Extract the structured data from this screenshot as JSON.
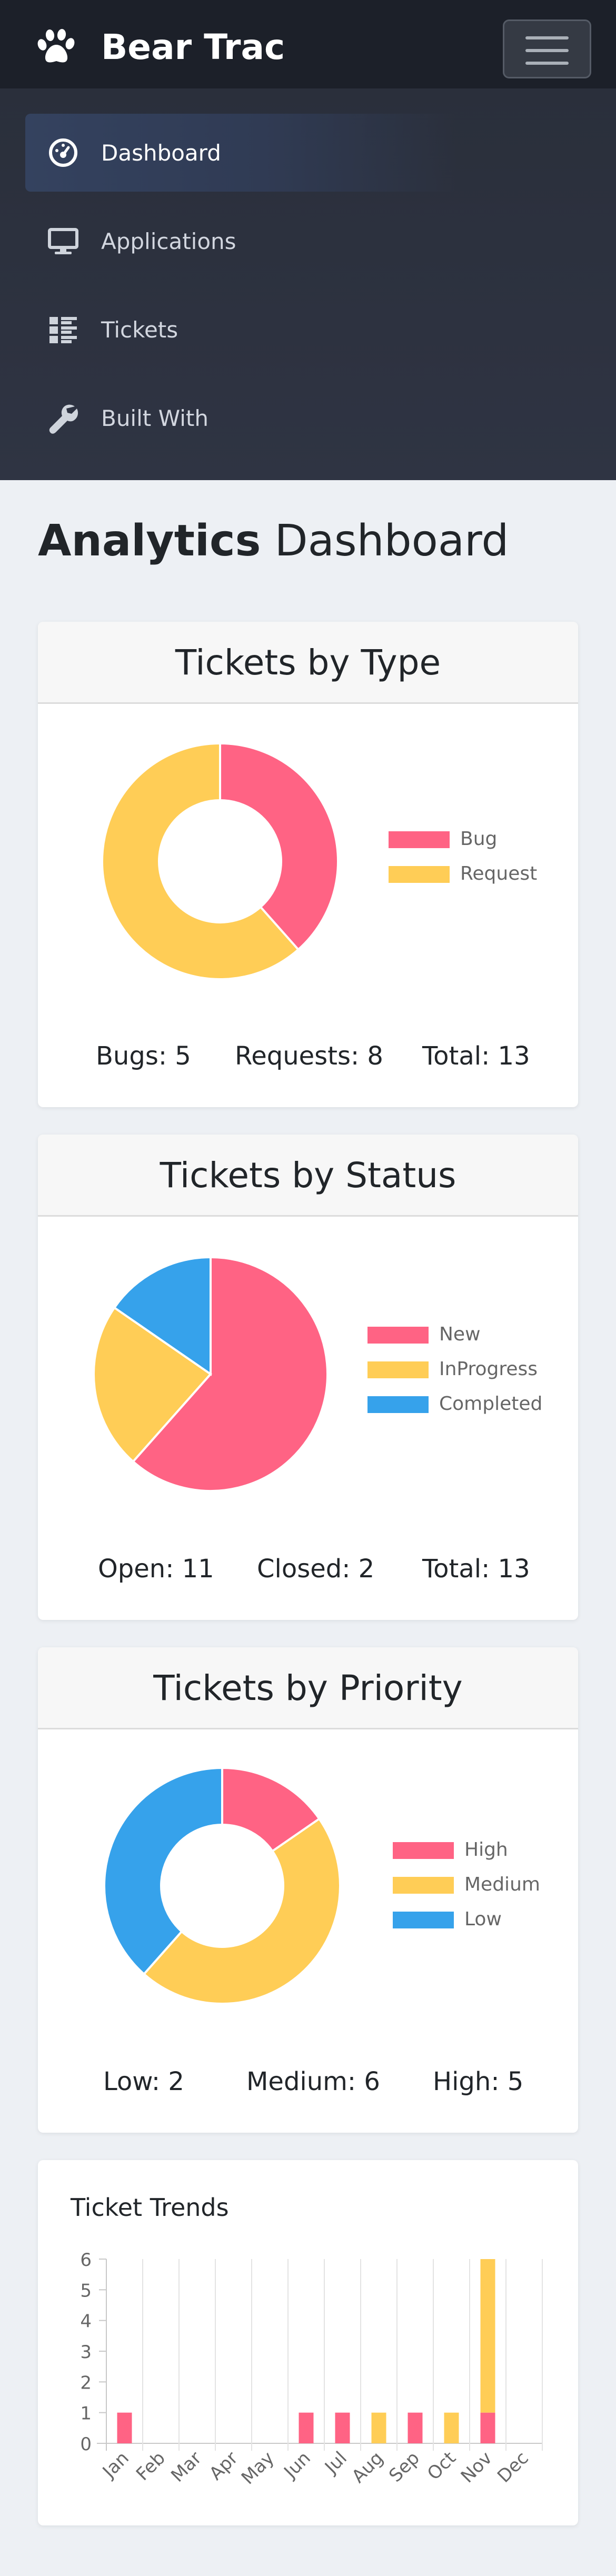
{
  "header": {
    "brand": "Bear Trac",
    "brand_icon": "paw-icon",
    "menu_icon": "hamburger-icon"
  },
  "nav": {
    "items": [
      {
        "label": "Dashboard",
        "icon": "gauge-icon",
        "active": true
      },
      {
        "label": "Applications",
        "icon": "desktop-icon",
        "active": false
      },
      {
        "label": "Tickets",
        "icon": "list-icon",
        "active": false
      },
      {
        "label": "Built With",
        "icon": "wrench-icon",
        "active": false
      }
    ]
  },
  "page": {
    "title_bold": "Analytics",
    "title_rest": " Dashboard"
  },
  "colors": {
    "pink": "#ff6384",
    "yellow": "#ffcd56",
    "blue": "#36a2eb"
  },
  "cards": {
    "by_type": {
      "title": "Tickets by Type",
      "stats": [
        "Bugs: 5",
        "Requests: 8",
        "Total: 13"
      ]
    },
    "by_status": {
      "title": "Tickets by Status",
      "stats": [
        "Open: 11",
        "Closed: 2",
        "Total: 13"
      ]
    },
    "by_priority": {
      "title": "Tickets by Priority",
      "stats": [
        "Low: 2",
        "Medium: 6",
        "High: 5"
      ]
    },
    "trends": {
      "title": "Ticket Trends"
    }
  },
  "chart_data": [
    {
      "type": "pie",
      "variant": "doughnut",
      "categories": [
        "Bug",
        "Request"
      ],
      "values": [
        5,
        8
      ],
      "colors": [
        "#ff6384",
        "#ffcd56"
      ],
      "legend": "right"
    },
    {
      "type": "pie",
      "categories": [
        "New",
        "InProgress",
        "Completed"
      ],
      "values": [
        8,
        3,
        2
      ],
      "colors": [
        "#ff6384",
        "#ffcd56",
        "#36a2eb"
      ],
      "legend": "right"
    },
    {
      "type": "pie",
      "variant": "doughnut",
      "categories": [
        "High",
        "Medium",
        "Low"
      ],
      "values": [
        2,
        6,
        5
      ],
      "colors": [
        "#ff6384",
        "#ffcd56",
        "#36a2eb"
      ],
      "legend": "right"
    },
    {
      "type": "bar",
      "stacked": true,
      "categories": [
        "Jan",
        "Feb",
        "Mar",
        "Apr",
        "May",
        "Jun",
        "Jul",
        "Aug",
        "Sep",
        "Oct",
        "Nov",
        "Dec"
      ],
      "series": [
        {
          "color": "#ff6384",
          "values": [
            1,
            0,
            0,
            0,
            0,
            1,
            1,
            0,
            1,
            0,
            1,
            0
          ]
        },
        {
          "color": "#ffcd56",
          "values": [
            0,
            0,
            0,
            0,
            0,
            0,
            0,
            1,
            0,
            1,
            5,
            0
          ]
        }
      ],
      "yticks": [
        "0",
        "1",
        "2",
        "3",
        "4",
        "5",
        "6"
      ],
      "ylim": [
        0,
        6
      ],
      "grid": true
    }
  ]
}
